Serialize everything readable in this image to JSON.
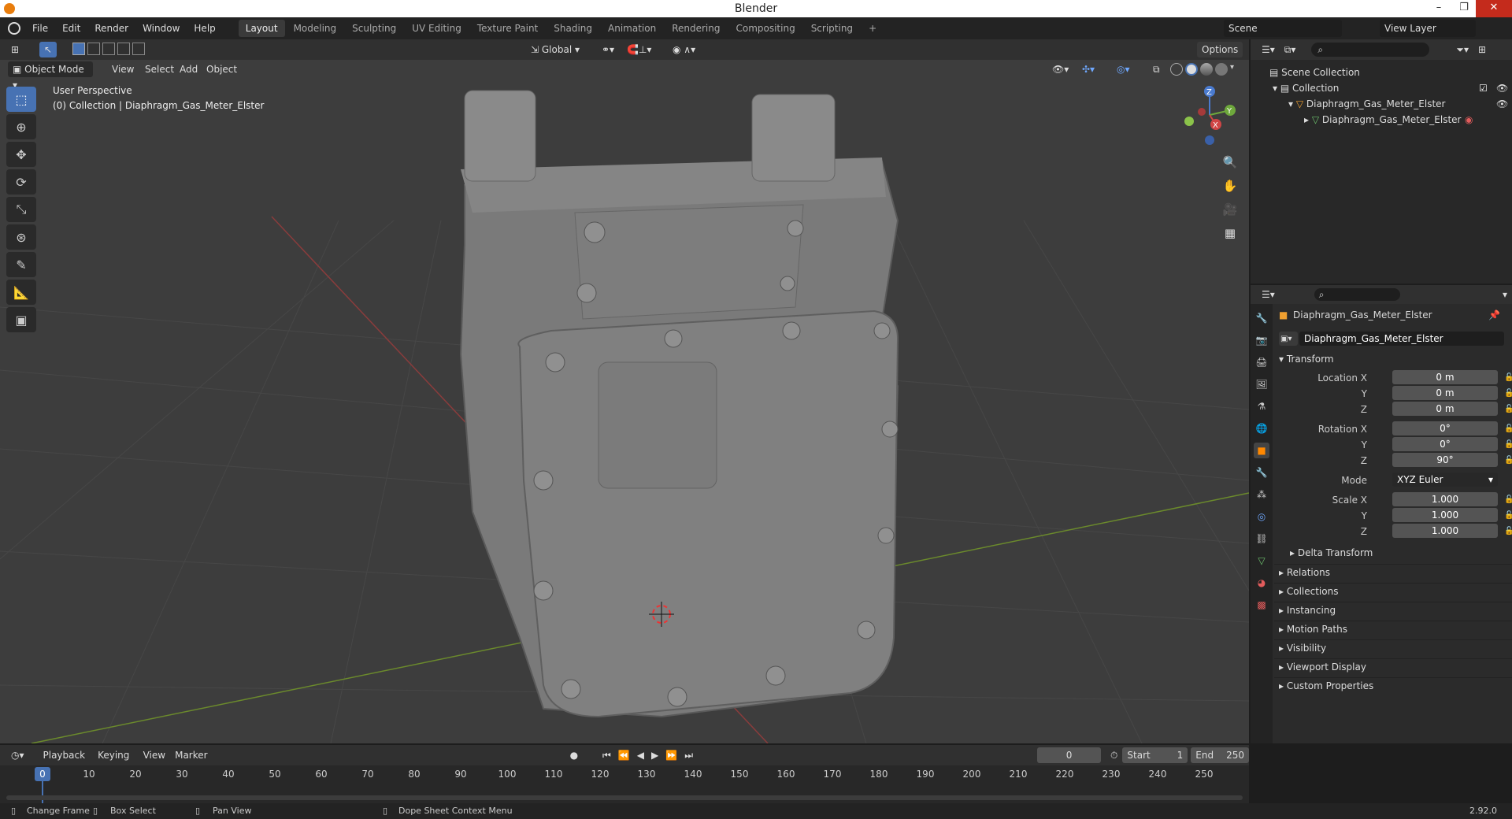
{
  "window": {
    "title": "Blender",
    "minimize": "–",
    "maximize": "❐",
    "close": "✕"
  },
  "menu": {
    "items": [
      "File",
      "Edit",
      "Render",
      "Window",
      "Help"
    ]
  },
  "workspaces": {
    "tabs": [
      "Layout",
      "Modeling",
      "Sculpting",
      "UV Editing",
      "Texture Paint",
      "Shading",
      "Animation",
      "Rendering",
      "Compositing",
      "Scripting"
    ],
    "active": "Layout",
    "add": "+"
  },
  "scene": {
    "name": "Scene",
    "view_layer": "View Layer"
  },
  "viewport": {
    "header": {
      "transform_orientation": "Global",
      "options": "Options"
    },
    "mode": "Object Mode",
    "menus": [
      "View",
      "Select",
      "Add",
      "Object"
    ],
    "perspective_label": "User Perspective",
    "collection_label": "(0) Collection | Diaphragm_Gas_Meter_Elster",
    "gizmo": {
      "z": "Z",
      "y": "Y",
      "x": "X"
    }
  },
  "outliner": {
    "root": "Scene Collection",
    "collection": "Collection",
    "object": "Diaphragm_Gas_Meter_Elster",
    "mesh": "Diaphragm_Gas_Meter_Elster"
  },
  "properties": {
    "object_name": "Diaphragm_Gas_Meter_Elster",
    "datablock": "Diaphragm_Gas_Meter_Elster",
    "transform_title": "Transform",
    "location": {
      "label_x": "Location X",
      "x": "0 m",
      "y": "0 m",
      "z": "0 m"
    },
    "rotation": {
      "label_x": "Rotation X",
      "x": "0°",
      "y": "0°",
      "z": "90°"
    },
    "axis_y": "Y",
    "axis_z": "Z",
    "mode_label": "Mode",
    "mode_value": "XYZ Euler",
    "scale": {
      "label_x": "Scale X",
      "x": "1.000",
      "y": "1.000",
      "z": "1.000"
    },
    "delta": "Delta Transform",
    "sections": [
      "Relations",
      "Collections",
      "Instancing",
      "Motion Paths",
      "Visibility",
      "Viewport Display",
      "Custom Properties"
    ]
  },
  "timeline": {
    "menus": [
      "Playback",
      "Keying",
      "View",
      "Marker"
    ],
    "current_frame": "0",
    "start_label": "Start",
    "start": "1",
    "end_label": "End",
    "end": "250",
    "frames": [
      "0",
      "10",
      "20",
      "30",
      "40",
      "50",
      "60",
      "70",
      "80",
      "90",
      "100",
      "110",
      "120",
      "130",
      "140",
      "150",
      "160",
      "170",
      "180",
      "190",
      "200",
      "210",
      "220",
      "230",
      "240",
      "250"
    ]
  },
  "status": {
    "items": [
      "Change Frame",
      "Box Select",
      "Pan View",
      "Dope Sheet Context Menu"
    ],
    "version": "2.92.0"
  }
}
